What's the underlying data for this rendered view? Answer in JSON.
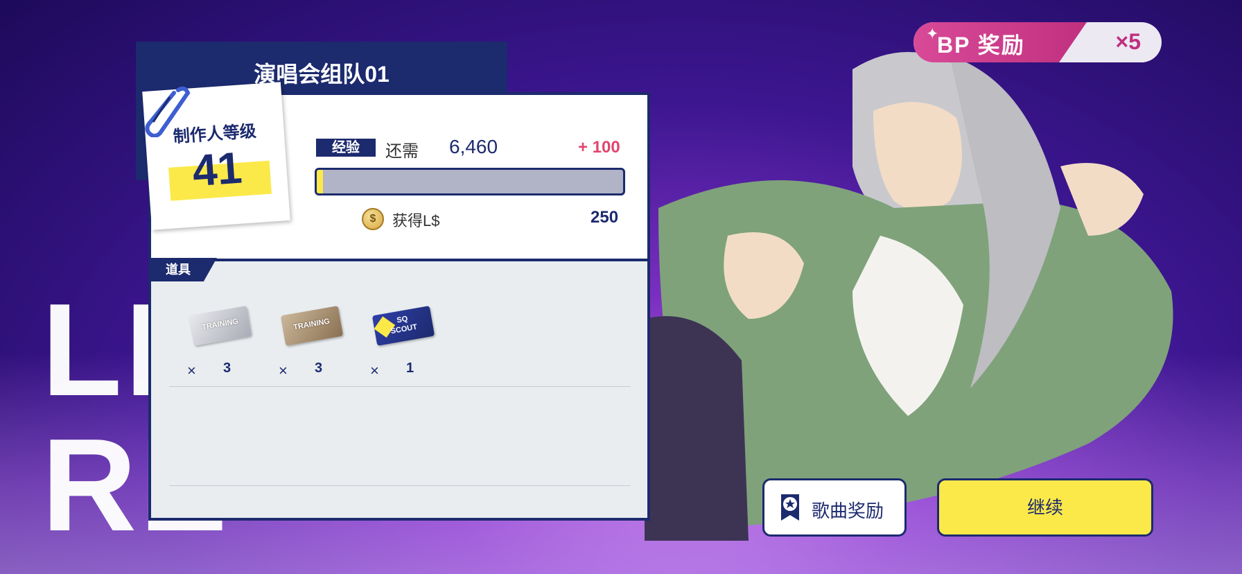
{
  "background": {
    "headline_line1": "LI",
    "headline_line2": "RE"
  },
  "bp_badge": {
    "label": "BP  奖励",
    "multiplier": "×5"
  },
  "panel": {
    "team_title": "演唱会组队01",
    "producer_level": {
      "label": "制作人等级",
      "value": "41"
    },
    "experience": {
      "tag": "经验",
      "need_label": "还需",
      "need_value": "6,460",
      "gain": "+ 100",
      "progress_fraction": 0.02
    },
    "currency": {
      "icon": "coin-icon",
      "label": "获得L$",
      "value": "250"
    },
    "items": {
      "tab_label": "道具",
      "list": [
        {
          "icon": "training-ticket-silver-icon",
          "ticket_text": "TRAINING",
          "times": "×",
          "count": "3"
        },
        {
          "icon": "training-ticket-bronze-icon",
          "ticket_text": "TRAINING",
          "times": "×",
          "count": "3"
        },
        {
          "icon": "sq-scout-ticket-icon",
          "ticket_text_line1": "SQ",
          "ticket_text_line2": "SCOUT",
          "times": "×",
          "count": "1"
        }
      ]
    }
  },
  "buttons": {
    "song_reward": "歌曲奖励",
    "continue": "继续"
  },
  "colors": {
    "navy": "#1c2a6e",
    "yellow": "#fbe94a",
    "pink": "#c0307f",
    "gain_red": "#e0466e"
  }
}
